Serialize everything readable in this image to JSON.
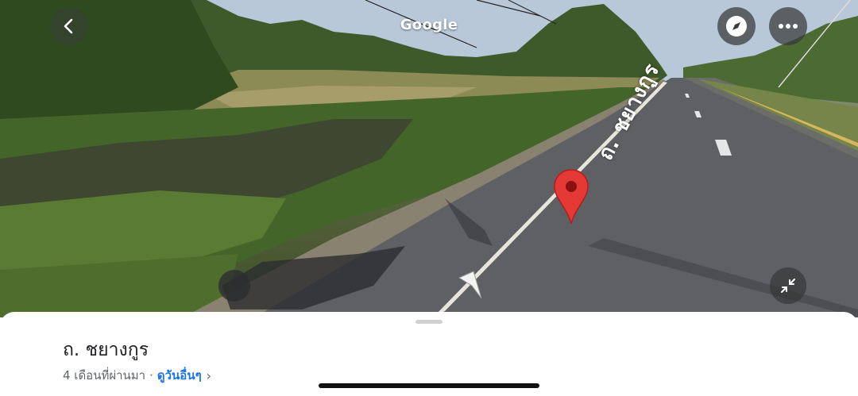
{
  "streetview": {
    "brand": "Google",
    "road_label": "ถ. ชยางกูร"
  },
  "icons": {
    "back": "chevron-left-icon",
    "compass": "compass-icon",
    "more": "more-horizontal-icon",
    "shrink": "collapse-arrows-icon",
    "pin": "map-pin-icon",
    "arrow": "navigation-arrow-icon"
  },
  "colors": {
    "pin": "#e53935",
    "link": "#1a73e8",
    "button_bg": "#3a3a3a"
  },
  "sheet": {
    "title": "ถ. ชยางกูร",
    "date": "4 เดือนที่ผ่านมา",
    "separator": "·",
    "see_more": "ดูวันอื่นๆ",
    "chevron": "›"
  }
}
